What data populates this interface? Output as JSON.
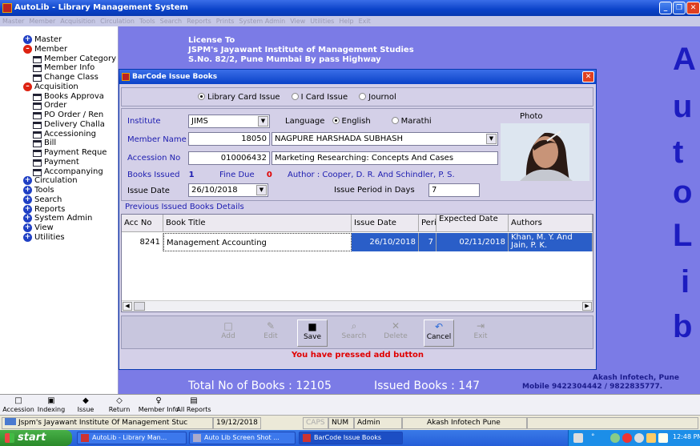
{
  "window": {
    "title": "AutoLib - Library Management System"
  },
  "menu": [
    "Master",
    "Member",
    "Acquisition",
    "Circulation",
    "Tools",
    "Search",
    "Reports",
    "Prints",
    "System Admin",
    "View",
    "Utilities",
    "Help",
    "Exit"
  ],
  "tree": [
    {
      "label": "Master",
      "kind": "plus"
    },
    {
      "label": "Member",
      "kind": "minus"
    },
    {
      "label": "Member Category",
      "kind": "leaf"
    },
    {
      "label": "Member Info",
      "kind": "leaf"
    },
    {
      "label": "Change Class",
      "kind": "leaf"
    },
    {
      "label": "Acquisition",
      "kind": "minus"
    },
    {
      "label": "Books Approva",
      "kind": "leaf"
    },
    {
      "label": "Order",
      "kind": "leaf"
    },
    {
      "label": "PO Order / Ren",
      "kind": "leaf"
    },
    {
      "label": "Delivery Challa",
      "kind": "leaf"
    },
    {
      "label": "Accessioning",
      "kind": "leaf"
    },
    {
      "label": "Bill",
      "kind": "leaf"
    },
    {
      "label": "Payment Reque",
      "kind": "leaf"
    },
    {
      "label": "Payment",
      "kind": "leaf"
    },
    {
      "label": "Accompanying",
      "kind": "leaf"
    },
    {
      "label": "Circulation",
      "kind": "plus"
    },
    {
      "label": "Tools",
      "kind": "plus"
    },
    {
      "label": "Search",
      "kind": "plus"
    },
    {
      "label": "Reports",
      "kind": "plus"
    },
    {
      "label": "System Admin",
      "kind": "plus"
    },
    {
      "label": "View",
      "kind": "plus"
    },
    {
      "label": "Utilities",
      "kind": "plus"
    }
  ],
  "license": {
    "line1": "License To",
    "line2": "JSPM's Jayawant Institute of Management Studies",
    "line3": "S.No. 82/2, Pune Mumbai By pass Highway"
  },
  "brand_letters": [
    "A",
    "u",
    "t",
    "o",
    "L",
    "i",
    "b"
  ],
  "footer_info": {
    "total_books": "Total No of Books : 12105",
    "issued_books": "Issued Books : 147",
    "company": "Akash Infotech, Pune",
    "mobile": "Mobile 9422304442 / 9822835777."
  },
  "dialog": {
    "title": "BarCode Issue Books",
    "issue_types": [
      {
        "label": "Library Card Issue",
        "selected": true
      },
      {
        "label": "I Card Issue",
        "selected": false
      },
      {
        "label": "Journol",
        "selected": false
      }
    ],
    "institute_label": "Institute",
    "institute_value": "JIMS",
    "language_label": "Language",
    "language_options": [
      {
        "label": "English",
        "selected": true
      },
      {
        "label": "Marathi",
        "selected": false
      }
    ],
    "photo_label": "Photo",
    "member_label": "Member Name",
    "member_id": "18050",
    "member_name": "NAGPURE HARSHADA SUBHASH",
    "accession_label": "Accession No",
    "accession_no": "010006432",
    "book_title": "Marketing Researching: Concepts And Cases",
    "books_issued_label": "Books Issued",
    "books_issued": "1",
    "fine_due_label": "Fine Due",
    "fine_due": "0",
    "author_text": "Author : Cooper, D. R. And  Schindler, P. S.",
    "issue_date_label": "Issue Date",
    "issue_date": "26/10/2018",
    "period_label": "Issue Period in Days",
    "period": "7",
    "grid_title": "Previous Issued Books Details",
    "grid_headers": [
      "Acc No",
      "Book Title",
      "Issue Date",
      "Perid",
      "Expected Date",
      "Authors"
    ],
    "grid_rows": [
      {
        "acc": "8241",
        "title": "Management Accounting",
        "issue_date": "26/10/2018",
        "period": "7",
        "expected": "02/11/2018",
        "authors": "Khan, M. Y. And Jain, P. K."
      }
    ],
    "buttons": [
      {
        "label": "Add",
        "icon": "□",
        "enabled": false
      },
      {
        "label": "Edit",
        "icon": "✎",
        "enabled": false
      },
      {
        "label": "Save",
        "icon": "■",
        "enabled": true
      },
      {
        "label": "Search",
        "icon": "⌕",
        "enabled": false
      },
      {
        "label": "Delete",
        "icon": "✕",
        "enabled": false
      },
      {
        "label": "Cancel",
        "icon": "↶",
        "enabled": true
      },
      {
        "label": "Exit",
        "icon": "⇥",
        "enabled": false
      }
    ],
    "message": "You have pressed add button"
  },
  "quickbar": [
    {
      "label": "Accession",
      "icon": "□"
    },
    {
      "label": "Indexing",
      "icon": "▣"
    },
    {
      "label": "Issue",
      "icon": "◆"
    },
    {
      "label": "Return",
      "icon": "◇"
    },
    {
      "label": "Member Info",
      "icon": "♀"
    },
    {
      "label": "All Reports",
      "icon": "▤"
    }
  ],
  "status": {
    "institute": "Jspm's Jayawant Institute Of Management Stuc",
    "date": "19/12/2018",
    "caps": "CAPS",
    "num": "NUM",
    "user": "Admin",
    "company": "Akash Infotech Pune"
  },
  "taskbar": {
    "start": "start",
    "tasks": [
      "AutoLib - Library Man...",
      "Auto Lib Screen Shot ...",
      "BarCode Issue Books"
    ],
    "clock": "12:48 PM"
  }
}
